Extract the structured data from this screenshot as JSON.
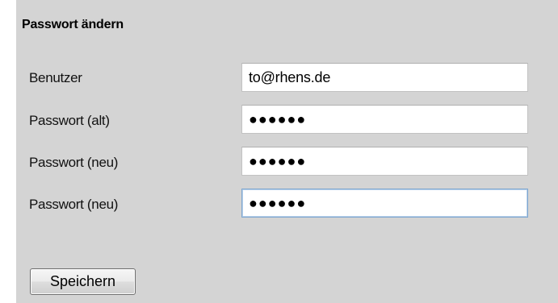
{
  "form": {
    "title": "Passwort ändern",
    "fields": [
      {
        "label": "Benutzer",
        "value": "to@rhens.de",
        "type": "text"
      },
      {
        "label": "Passwort (alt)",
        "value": "●●●●●●",
        "type": "password"
      },
      {
        "label": "Passwort (neu)",
        "value": "●●●●●●",
        "type": "password"
      },
      {
        "label": "Passwort (neu)",
        "value": "●●●●●●",
        "type": "password"
      }
    ],
    "save_label": "Speichern"
  },
  "colors": {
    "panel_background": "#d4d4d4",
    "field_background": "#ffffff",
    "focus_border": "#7ea6cf"
  }
}
